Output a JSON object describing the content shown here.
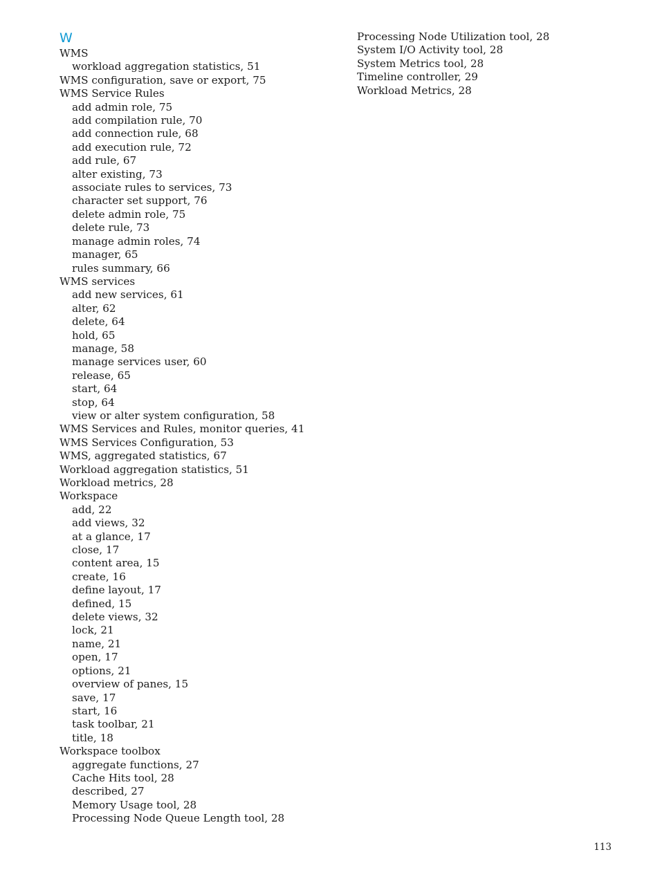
{
  "document": {
    "type": "book-index-page",
    "page_number": "113",
    "section_letter": "W",
    "accent_color": "#119ad4",
    "text_color": "#1c1c1c",
    "background_color": "#ffffff"
  },
  "columns": [
    {
      "id": "left",
      "entries": [
        {
          "text": "WMS",
          "level": 0
        },
        {
          "text": "workload aggregation statistics, 51",
          "level": 1
        },
        {
          "text": "WMS configuration, save or export, 75",
          "level": 0
        },
        {
          "text": "WMS Service Rules",
          "level": 0
        },
        {
          "text": "add admin role, 75",
          "level": 1
        },
        {
          "text": "add compilation rule, 70",
          "level": 1
        },
        {
          "text": "add connection rule, 68",
          "level": 1
        },
        {
          "text": "add execution rule, 72",
          "level": 1
        },
        {
          "text": "add rule, 67",
          "level": 1
        },
        {
          "text": "alter existing, 73",
          "level": 1
        },
        {
          "text": "associate rules to services, 73",
          "level": 1
        },
        {
          "text": "character set support, 76",
          "level": 1
        },
        {
          "text": "delete admin role, 75",
          "level": 1
        },
        {
          "text": "delete rule, 73",
          "level": 1
        },
        {
          "text": "manage admin roles, 74",
          "level": 1
        },
        {
          "text": "manager, 65",
          "level": 1
        },
        {
          "text": "rules summary, 66",
          "level": 1
        },
        {
          "text": "WMS services",
          "level": 0
        },
        {
          "text": "add new services, 61",
          "level": 1
        },
        {
          "text": "alter, 62",
          "level": 1
        },
        {
          "text": "delete, 64",
          "level": 1
        },
        {
          "text": "hold, 65",
          "level": 1
        },
        {
          "text": "manage, 58",
          "level": 1
        },
        {
          "text": "manage services user, 60",
          "level": 1
        },
        {
          "text": "release, 65",
          "level": 1
        },
        {
          "text": "start, 64",
          "level": 1
        },
        {
          "text": "stop, 64",
          "level": 1
        },
        {
          "text": "view or alter system configuration, 58",
          "level": 1
        },
        {
          "text": "WMS Services and Rules, monitor queries, 41",
          "level": 0
        },
        {
          "text": "WMS Services Configuration, 53",
          "level": 0
        },
        {
          "text": "WMS, aggregated statistics, 67",
          "level": 0
        },
        {
          "text": "Workload aggregation statistics, 51",
          "level": 0
        },
        {
          "text": "Workload metrics, 28",
          "level": 0
        },
        {
          "text": "Workspace",
          "level": 0
        },
        {
          "text": "add, 22",
          "level": 1
        },
        {
          "text": "add views, 32",
          "level": 1
        },
        {
          "text": "at a glance, 17",
          "level": 1
        },
        {
          "text": "close, 17",
          "level": 1
        },
        {
          "text": "content area, 15",
          "level": 1
        },
        {
          "text": "create, 16",
          "level": 1
        },
        {
          "text": "define layout, 17",
          "level": 1
        },
        {
          "text": "defined, 15",
          "level": 1
        },
        {
          "text": "delete views, 32",
          "level": 1
        },
        {
          "text": "lock, 21",
          "level": 1
        },
        {
          "text": "name, 21",
          "level": 1
        },
        {
          "text": "open, 17",
          "level": 1
        },
        {
          "text": "options, 21",
          "level": 1
        },
        {
          "text": "overview of panes, 15",
          "level": 1
        },
        {
          "text": "save, 17",
          "level": 1
        },
        {
          "text": "start, 16",
          "level": 1
        },
        {
          "text": "task toolbar, 21",
          "level": 1
        },
        {
          "text": "title, 18",
          "level": 1
        },
        {
          "text": "Workspace toolbox",
          "level": 0
        },
        {
          "text": "aggregate functions, 27",
          "level": 1
        },
        {
          "text": "Cache Hits tool, 28",
          "level": 1
        },
        {
          "text": "described, 27",
          "level": 1
        },
        {
          "text": "Memory Usage tool, 28",
          "level": 1
        },
        {
          "text": "Processing Node Queue Length tool, 28",
          "level": 1
        }
      ]
    },
    {
      "id": "right",
      "entries": [
        {
          "text": "Processing Node Utilization tool, 28",
          "level": 0
        },
        {
          "text": "System I/O Activity tool, 28",
          "level": 0
        },
        {
          "text": "System Metrics tool, 28",
          "level": 0
        },
        {
          "text": "Timeline controller, 29",
          "level": 0
        },
        {
          "text": "Workload Metrics, 28",
          "level": 0
        }
      ]
    }
  ]
}
